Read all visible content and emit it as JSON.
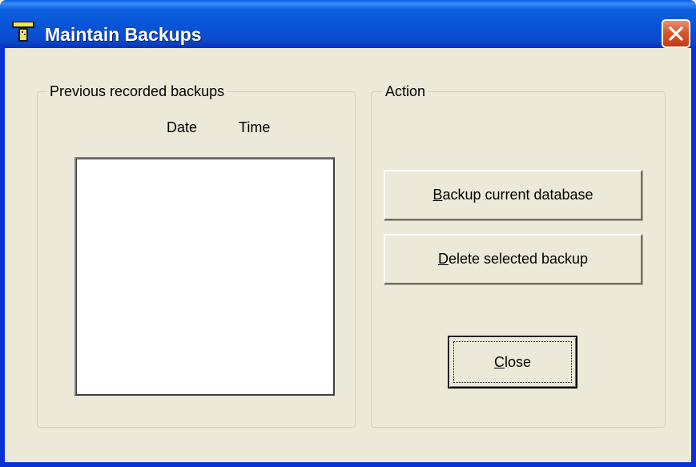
{
  "window": {
    "title": "Maintain Backups",
    "app_icon": "phone-app-icon",
    "close_icon": "close-icon"
  },
  "previous_backups": {
    "legend": "Previous recorded backups",
    "columns": [
      "Date",
      "Time"
    ],
    "items": []
  },
  "action": {
    "legend": "Action",
    "backup_button": {
      "mnemonic": "B",
      "rest": "ackup current database"
    },
    "delete_button": {
      "mnemonic": "D",
      "rest": "elete selected backup"
    },
    "close_button": {
      "mnemonic": "C",
      "rest": "lose"
    }
  },
  "colors": {
    "titlebar": "#0853d6",
    "window_bg": "#ece9d8",
    "close_button": "#d9582e"
  }
}
